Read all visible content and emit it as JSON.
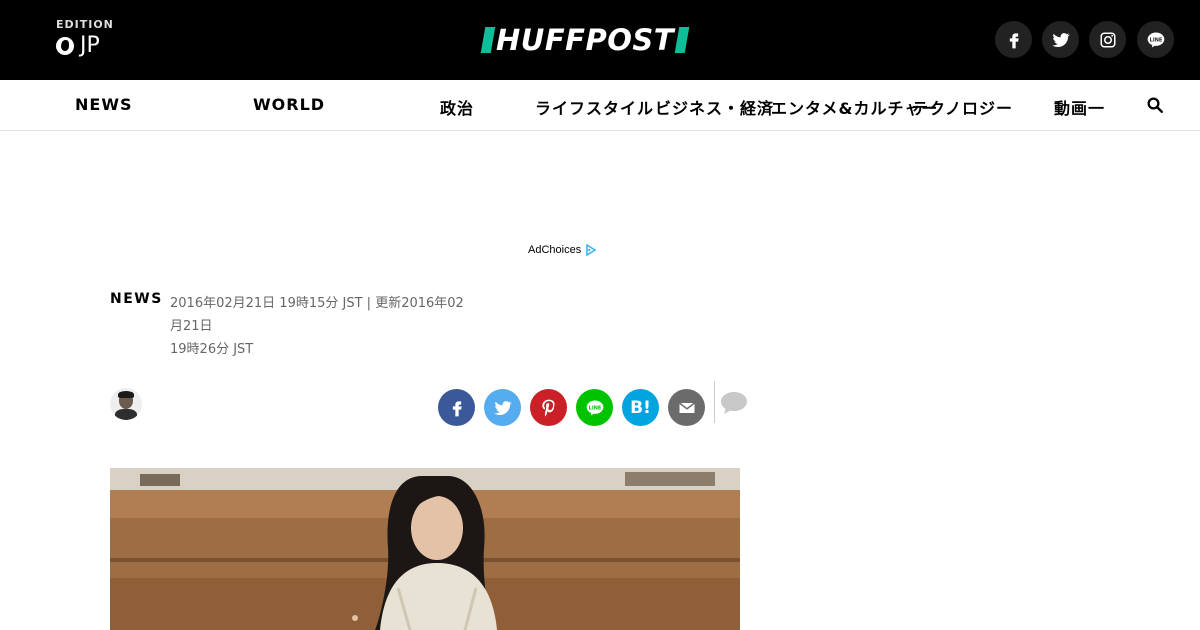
{
  "header": {
    "edition_label": "EDITION",
    "edition_code": "JP",
    "logo_text": "HUFFPOST",
    "social": [
      {
        "icon": "facebook-icon",
        "glyph": "f"
      },
      {
        "icon": "twitter-icon",
        "glyph": ""
      },
      {
        "icon": "instagram-icon",
        "glyph": ""
      },
      {
        "icon": "line-icon",
        "glyph": "LINE"
      }
    ]
  },
  "nav": {
    "items": [
      "NEWS",
      "WORLD",
      "政治",
      "ライフスタイル",
      "ビジネス・経済",
      "エンタメ&カルチャー",
      "テクノロジー",
      "動画一"
    ]
  },
  "ad": {
    "adchoices_label": "AdChoices"
  },
  "article": {
    "section": "NEWS",
    "dateline_1": "2016年02月21日 19時15分 JST | 更新2016年02月21日",
    "dateline_2": "19時26分 JST"
  },
  "share": {
    "hatena_label": "B!",
    "line_label": "LINE"
  },
  "colors": {
    "accent": "#0dbe98",
    "facebook": "#3b5998",
    "twitter": "#55acee",
    "pinterest": "#cb2027",
    "line": "#00c300",
    "hatena": "#00a4de",
    "email": "#6b6b6b"
  }
}
